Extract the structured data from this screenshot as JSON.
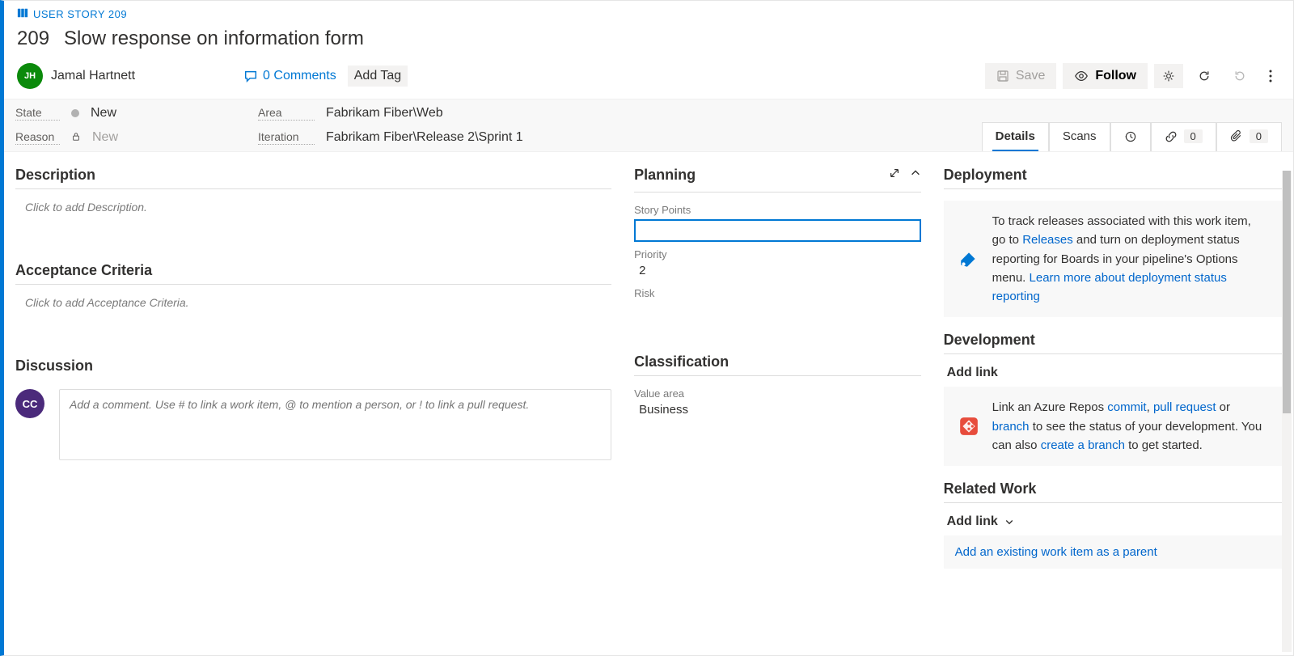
{
  "breadcrumb": {
    "type_label": "USER STORY 209"
  },
  "work_item": {
    "id": "209",
    "title": "Slow response on information form",
    "assignee_initials": "JH",
    "assignee_name": "Jamal Hartnett",
    "comments_count": "0 Comments",
    "add_tag_label": "Add Tag"
  },
  "actions": {
    "save": "Save",
    "follow": "Follow"
  },
  "state_bar": {
    "state_label": "State",
    "state_value": "New",
    "reason_label": "Reason",
    "reason_value": "New",
    "area_label": "Area",
    "area_value": "Fabrikam Fiber\\Web",
    "iteration_label": "Iteration",
    "iteration_value": "Fabrikam Fiber\\Release 2\\Sprint 1"
  },
  "tabs": {
    "details": "Details",
    "scans": "Scans",
    "links_count": "0",
    "attachments_count": "0"
  },
  "sections": {
    "description": "Description",
    "description_placeholder": "Click to add Description.",
    "acceptance": "Acceptance Criteria",
    "acceptance_placeholder": "Click to add Acceptance Criteria.",
    "discussion": "Discussion",
    "discussion_placeholder": "Add a comment. Use # to link a work item, @ to mention a person, or ! to link a pull request.",
    "discussion_avatar_initials": "CC"
  },
  "planning": {
    "title": "Planning",
    "story_points_label": "Story Points",
    "story_points_value": "",
    "priority_label": "Priority",
    "priority_value": "2",
    "risk_label": "Risk"
  },
  "classification": {
    "title": "Classification",
    "value_area_label": "Value area",
    "value_area_value": "Business"
  },
  "right": {
    "deployment_title": "Deployment",
    "deployment_text_1": "To track releases associated with this work item, go to ",
    "deployment_releases_link": "Releases",
    "deployment_text_2": " and turn on deployment status reporting for Boards in your pipeline's Options menu. ",
    "deployment_learn_link": "Learn more about deployment status reporting",
    "development_title": "Development",
    "development_addlink": "Add link",
    "development_text_1": "Link an Azure Repos ",
    "development_commit_link": "commit",
    "development_text_2": ", ",
    "development_pull_link": "pull request",
    "development_text_3": " or ",
    "development_branch_link": "branch",
    "development_text_4": " to see the status of your development. You can also ",
    "development_create_link": "create a branch",
    "development_text_5": " to get started.",
    "related_title": "Related Work",
    "related_addlink": "Add link",
    "related_parent_btn": "Add an existing work item as a parent"
  }
}
